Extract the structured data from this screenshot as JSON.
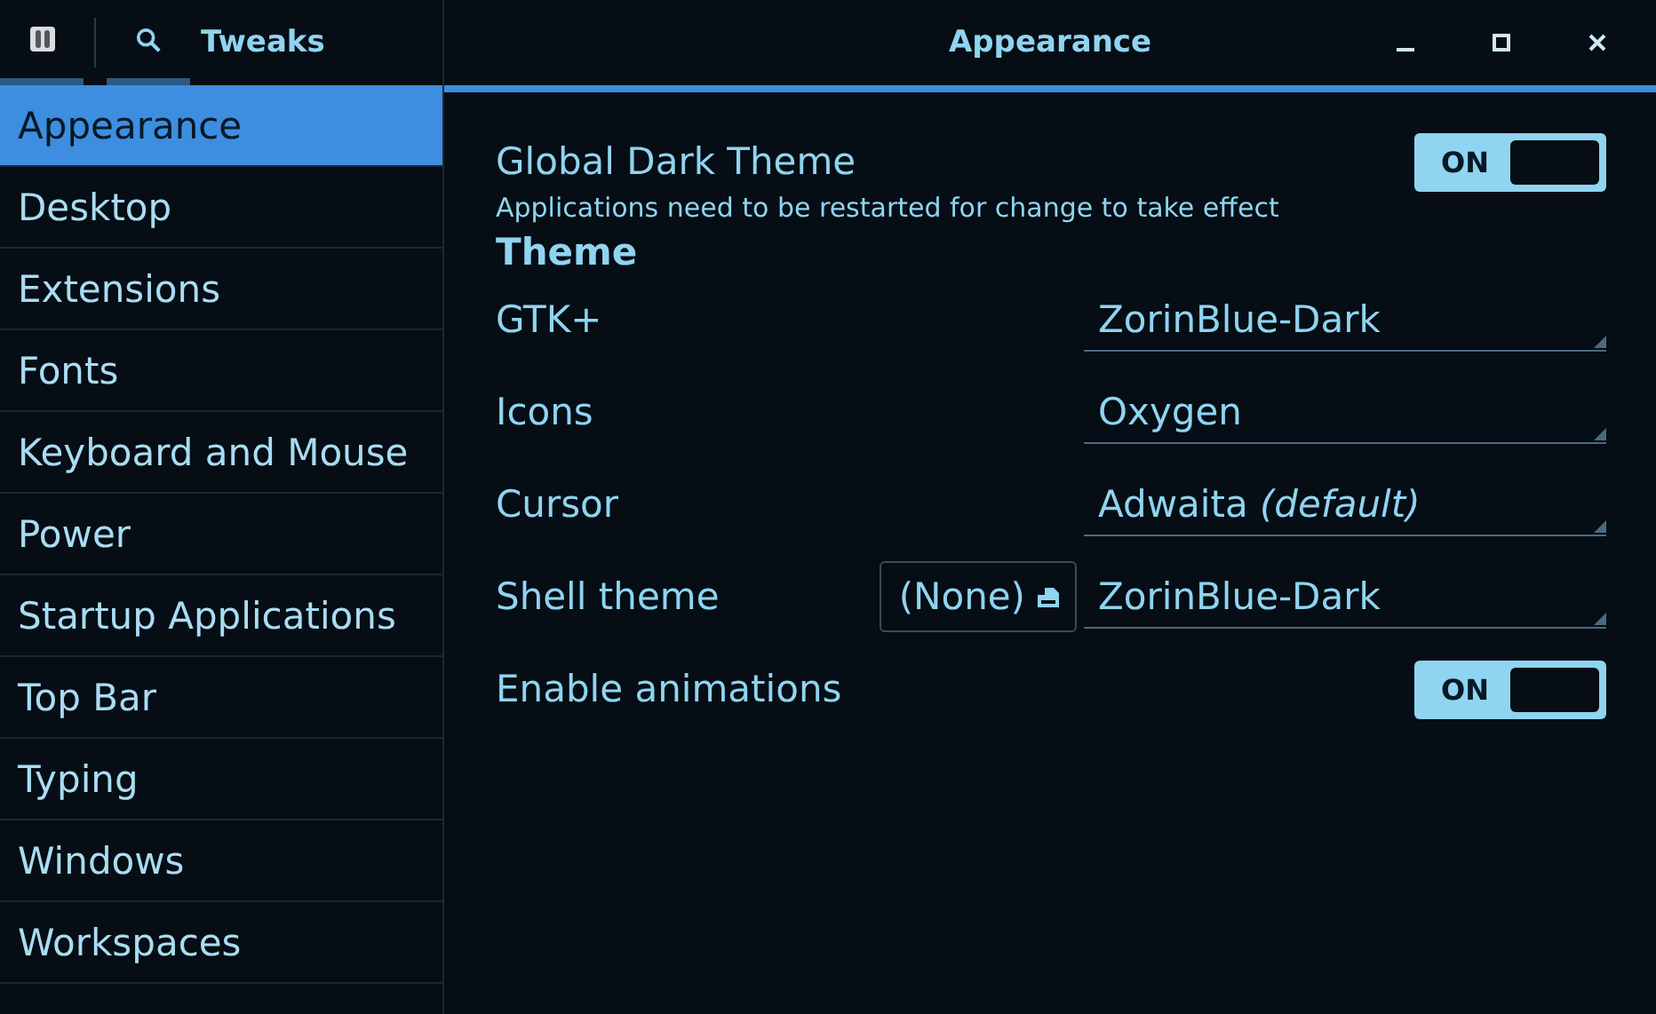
{
  "header": {
    "app_title": "Tweaks",
    "page_title": "Appearance"
  },
  "sidebar": {
    "items": [
      {
        "label": "Appearance",
        "selected": true
      },
      {
        "label": "Desktop",
        "selected": false
      },
      {
        "label": "Extensions",
        "selected": false
      },
      {
        "label": "Fonts",
        "selected": false
      },
      {
        "label": "Keyboard and Mouse",
        "selected": false
      },
      {
        "label": "Power",
        "selected": false
      },
      {
        "label": "Startup Applications",
        "selected": false
      },
      {
        "label": "Top Bar",
        "selected": false
      },
      {
        "label": "Typing",
        "selected": false
      },
      {
        "label": "Windows",
        "selected": false
      },
      {
        "label": "Workspaces",
        "selected": false
      }
    ]
  },
  "settings": [
    {
      "kind": "switch",
      "label": "Global Dark Theme",
      "note": "Applications need to be restarted for change to take effect",
      "switch_label": "ON",
      "on": true
    },
    {
      "kind": "heading",
      "label": "Theme"
    },
    {
      "kind": "combo",
      "label": "GTK+",
      "value": "ZorinBlue-Dark"
    },
    {
      "kind": "combo",
      "label": "Icons",
      "value": "Oxygen"
    },
    {
      "kind": "combo",
      "label": "Cursor",
      "value": "Adwaita *(default)*"
    },
    {
      "kind": "combo",
      "label": "Shell theme",
      "file_button": "(None)",
      "value": "ZorinBlue-Dark"
    },
    {
      "kind": "switch",
      "label": "Enable animations",
      "switch_label": "ON",
      "on": true
    }
  ]
}
